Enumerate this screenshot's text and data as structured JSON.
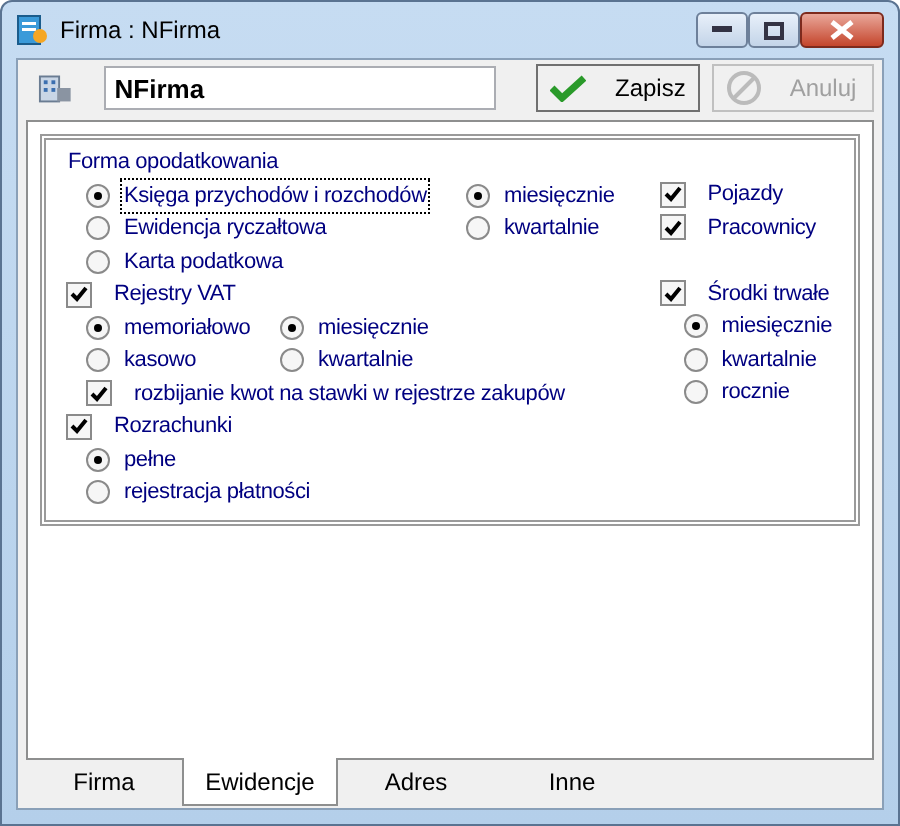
{
  "window": {
    "title": "Firma : NFirma"
  },
  "toolbar": {
    "name_field": "NFirma",
    "buttons": [
      {
        "label": "Zapisz",
        "kind": "save",
        "disabled": false
      },
      {
        "label": "Anuluj",
        "kind": "cancel",
        "disabled": true
      }
    ]
  },
  "taxation": {
    "label": "Forma opodatkowania",
    "forms": [
      {
        "label": "Księga przychodów i rozchodów",
        "selected": true,
        "focused": true
      },
      {
        "label": "Ewidencja ryczałtowa",
        "selected": false,
        "focused": false
      },
      {
        "label": "Karta podatkowa",
        "selected": false,
        "focused": false
      }
    ],
    "periods": [
      {
        "label": "miesięcznie",
        "selected": true
      },
      {
        "label": "kwartalnie",
        "selected": false
      }
    ]
  },
  "options": [
    {
      "label": "Pojazdy",
      "checked": true
    },
    {
      "label": "Pracownicy",
      "checked": true
    }
  ],
  "vat": {
    "label": "Rejestry VAT",
    "checked": true,
    "methods": [
      {
        "label": "memoriałowo",
        "selected": true
      },
      {
        "label": "kasowo",
        "selected": false
      }
    ],
    "periods": [
      {
        "label": "miesięcznie",
        "selected": true
      },
      {
        "label": "kwartalnie",
        "selected": false
      }
    ],
    "split": {
      "label": "rozbijanie kwot na stawki w rejestrze zakupów",
      "checked": true
    }
  },
  "fixed_assets": {
    "label": "Środki trwałe",
    "checked": true,
    "periods": [
      {
        "label": "miesięcznie",
        "selected": true
      },
      {
        "label": "kwartalnie",
        "selected": false
      },
      {
        "label": "rocznie",
        "selected": false
      }
    ]
  },
  "settlements": {
    "label": "Rozrachunki",
    "checked": true,
    "modes": [
      {
        "label": "pełne",
        "selected": true
      },
      {
        "label": "rejestracja płatności",
        "selected": false
      }
    ]
  },
  "tabs": [
    {
      "label": "Firma",
      "selected": false
    },
    {
      "label": "Ewidencje",
      "selected": true
    },
    {
      "label": "Adres",
      "selected": false
    },
    {
      "label": "Inne",
      "selected": false
    }
  ]
}
